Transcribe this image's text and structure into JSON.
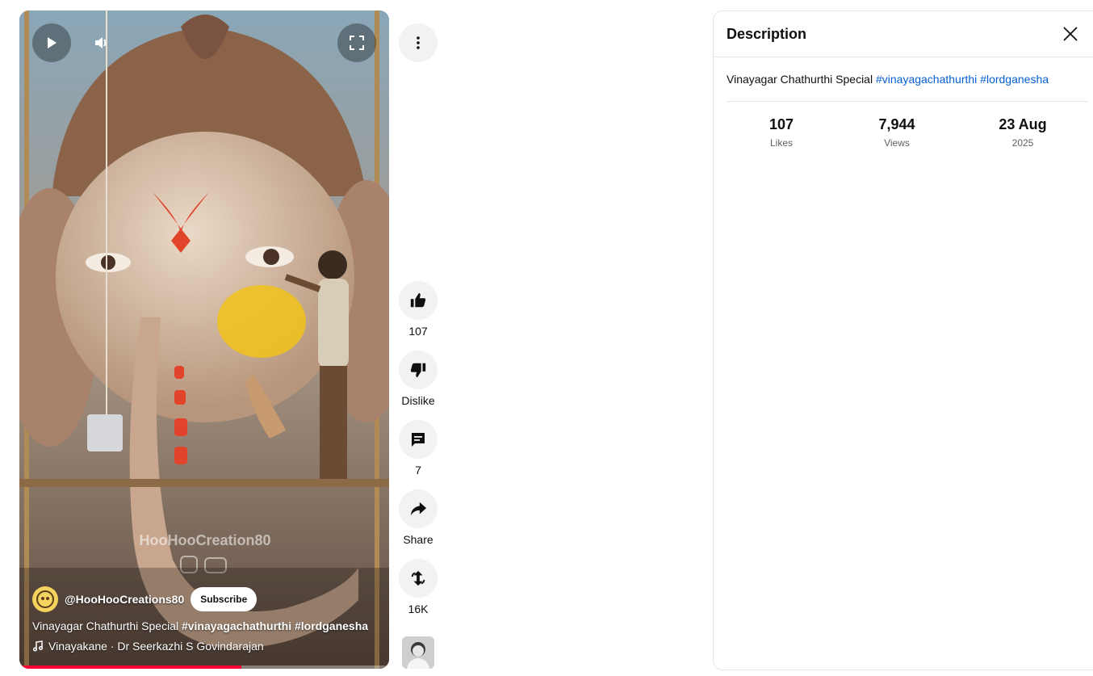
{
  "player": {
    "channel_name": "@HooHooCreations80",
    "subscribe_label": "Subscribe",
    "title_plain": "Vinayagar Chathurthi Special",
    "title_tags": "#vinayagachathurthi #lordganesha",
    "music": "Vinayakane · Dr Seerkazhi S Govindarajan",
    "watermark": "HooHooCreation80",
    "progress_percent": 60
  },
  "actions": {
    "like_count": "107",
    "dislike_label": "Dislike",
    "comment_count": "7",
    "share_label": "Share",
    "remix_count": "16K"
  },
  "description": {
    "title": "Description",
    "text": "Vinayagar Chathurthi Special",
    "hashtag_1": "#vinayagachathurthi",
    "hashtag_2": "#lordganesha",
    "stats": [
      {
        "value": "107",
        "caption": "Likes"
      },
      {
        "value": "7,944",
        "caption": "Views"
      },
      {
        "value": "23 Aug",
        "caption": "2025"
      }
    ]
  },
  "colors": {
    "accent_red": "#ff0033",
    "link_blue": "#065fd4",
    "button_bg": "#f2f2f2"
  }
}
